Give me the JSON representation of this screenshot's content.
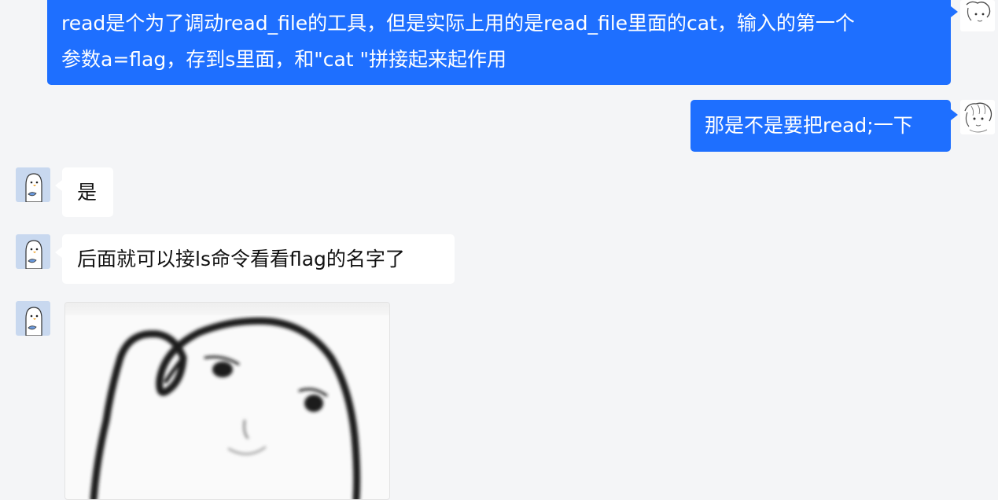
{
  "chat": {
    "messages": [
      {
        "sender": "me",
        "lines": [
          "read是个为了调动read_file的工具，但是实际上用的是read_file里面的cat，输入的第一个",
          "参数a=flag，存到s里面，和\"cat \"拼接起来起作用"
        ]
      },
      {
        "sender": "me",
        "lines": [
          "那是不是要把read;一下"
        ]
      },
      {
        "sender": "other",
        "lines": [
          "是"
        ]
      },
      {
        "sender": "other",
        "lines": [
          "后面就可以接ls命令看看flag的名字了"
        ]
      },
      {
        "sender": "other",
        "sticker": "blurry-meme-face-sticker"
      }
    ]
  },
  "colors": {
    "background": "#f4f5f7",
    "my_bubble": "#1e6fff",
    "their_bubble": "#ffffff"
  }
}
